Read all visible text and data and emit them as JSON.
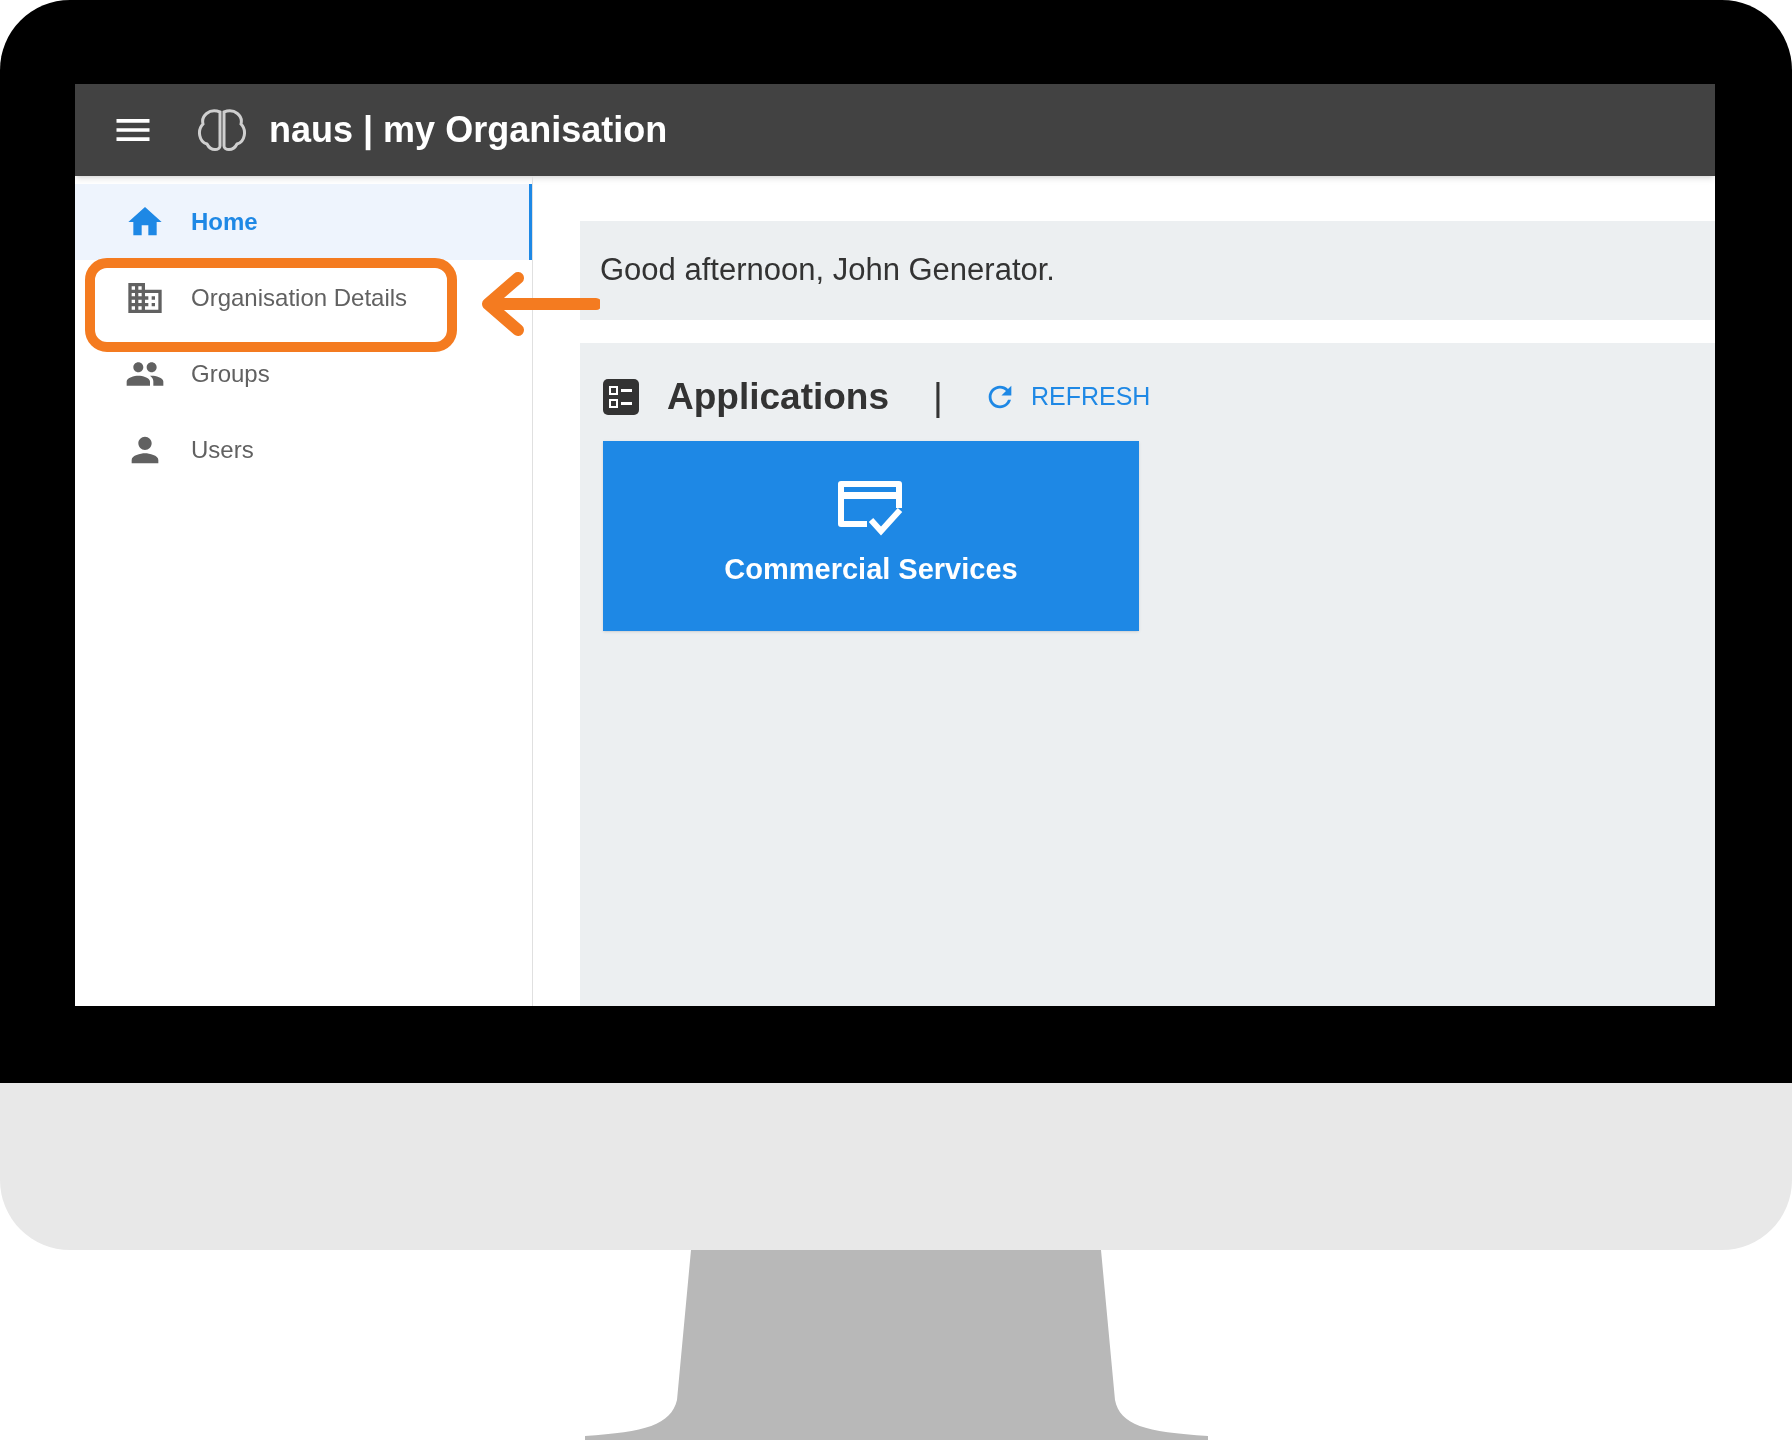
{
  "header": {
    "title": "naus | my Organisation"
  },
  "sidebar": {
    "items": [
      {
        "label": "Home",
        "selected": true,
        "highlighted": false
      },
      {
        "label": "Organisation Details",
        "selected": false,
        "highlighted": true
      },
      {
        "label": "Groups",
        "selected": false,
        "highlighted": false
      },
      {
        "label": "Users",
        "selected": false,
        "highlighted": false
      }
    ]
  },
  "greeting": "Good afternoon, John Generator.",
  "applications": {
    "title": "Applications",
    "separator": "|",
    "refresh": "REFRESH",
    "tiles": [
      {
        "label": "Commercial Services"
      }
    ]
  }
}
